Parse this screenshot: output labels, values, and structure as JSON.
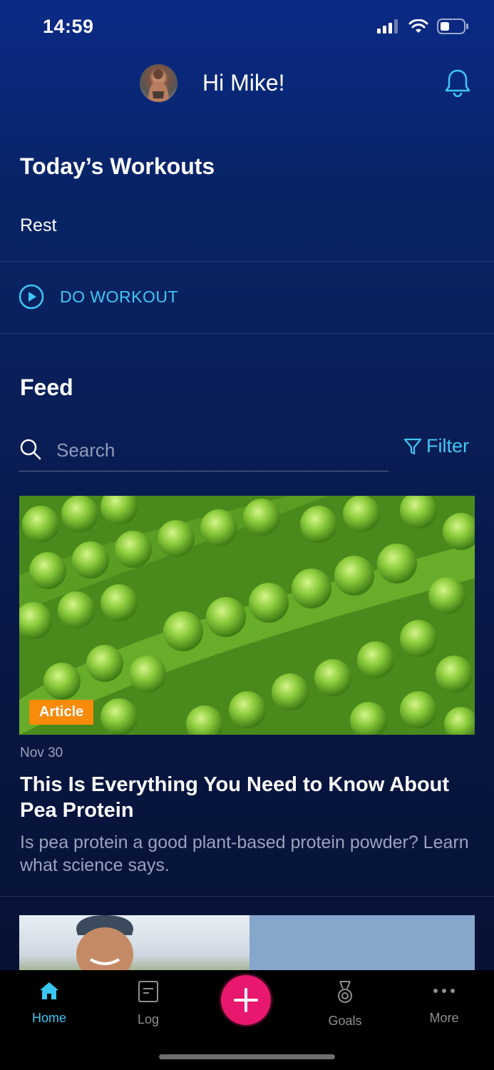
{
  "status_bar": {
    "time": "14:59"
  },
  "header": {
    "greeting": "Hi Mike!"
  },
  "workouts": {
    "title": "Today’s Workouts",
    "today": "Rest",
    "action_label": "DO WORKOUT"
  },
  "feed": {
    "title": "Feed",
    "search_placeholder": "Search",
    "filter_label": "Filter",
    "articles": [
      {
        "badge": "Article",
        "date": "Nov 30",
        "title": "This Is Everything You Need to Know About Pea Protein",
        "description": "Is pea protein a good plant-based protein powder? Learn what science says."
      }
    ]
  },
  "tabbar": {
    "items": [
      {
        "label": "Home",
        "icon": "home-icon",
        "active": true
      },
      {
        "label": "Log",
        "icon": "log-icon"
      },
      {
        "label": "",
        "icon": "plus-icon"
      },
      {
        "label": "Goals",
        "icon": "medal-icon"
      },
      {
        "label": "More",
        "icon": "more-icon"
      }
    ]
  },
  "colors": {
    "accent": "#3fc7f5",
    "badge": "#f88b0a",
    "fab": "#e8186e",
    "background_top": "#0a2a86",
    "background_bottom": "#06112f"
  }
}
